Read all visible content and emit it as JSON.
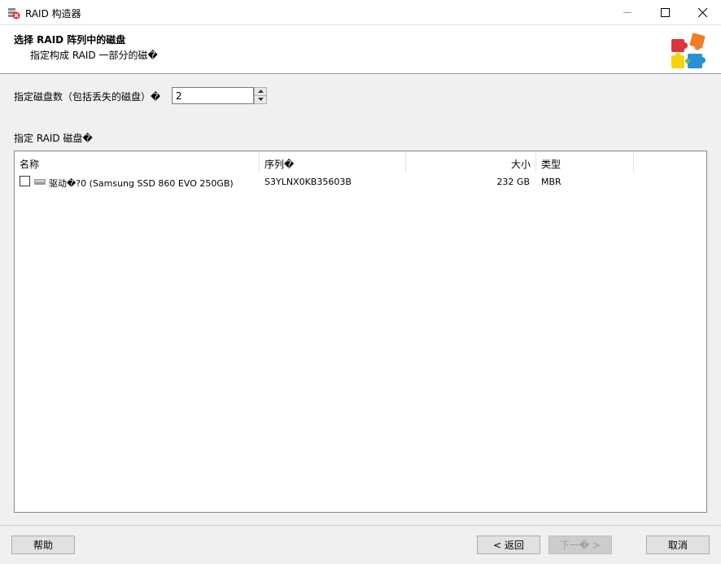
{
  "window": {
    "title": "RAID 构造器"
  },
  "header": {
    "title": "选择 RAID 阵列中的磁盘",
    "subtitle": "指定构成 RAID 一部分的磁�"
  },
  "disk_count": {
    "label": "指定磁盘数（包括丢失的磁盘）�",
    "value": "2"
  },
  "disks_label": "指定 RAID 磁盘�",
  "table": {
    "columns": [
      "名称",
      "序列�",
      "大小",
      "类型"
    ],
    "rows": [
      {
        "checked": false,
        "icon": "drive-icon",
        "name": "驱动�?0 (Samsung SSD 860 EVO 250GB)",
        "serial": "S3YLNX0KB35603B",
        "size": "232 GB",
        "type": "MBR"
      }
    ]
  },
  "buttons": {
    "help": "帮助",
    "back": "< 返回",
    "next": "下一� >",
    "cancel": "取消"
  }
}
